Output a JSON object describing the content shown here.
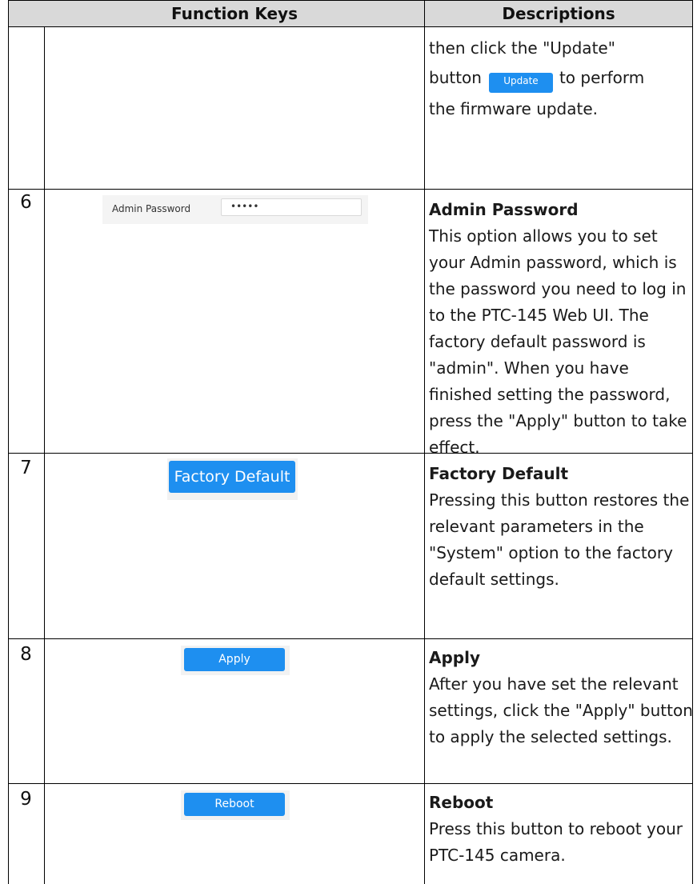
{
  "table": {
    "headers": {
      "function_keys": "Function Keys",
      "descriptions": "Descriptions"
    },
    "rows": [
      {
        "number": "",
        "description_lines": [
          "then click the \"Update\"",
          "button",
          "to perform",
          "the firmware update."
        ],
        "ui": {
          "update_button": "Update"
        }
      },
      {
        "number": "6",
        "title": "Admin Password",
        "body": "This option allows you to set your Admin password, which is the password you need to log in to the PTC-145 Web UI. The factory default password is \"admin\". When you have finished setting the password, press the \"Apply\" button to take effect.",
        "ui": {
          "label": "Admin Password",
          "value": "•••••"
        }
      },
      {
        "number": "7",
        "title": "Factory Default",
        "body": "Pressing this button restores the relevant parameters in the \"System\" option to the factory default settings.",
        "ui": {
          "button": "Factory Default"
        }
      },
      {
        "number": "8",
        "title": "Apply",
        "body": "After you have set the relevant settings, click the \"Apply\" button to apply the selected settings.",
        "ui": {
          "button": "Apply"
        }
      },
      {
        "number": "9",
        "title": "Reboot",
        "body": "Press this button to reboot your PTC-145 camera.",
        "ui": {
          "button": "Reboot"
        }
      }
    ]
  },
  "colors": {
    "header_bg": "#d9d9d9",
    "button_blue": "#1e8ff0",
    "border": "#000000"
  }
}
